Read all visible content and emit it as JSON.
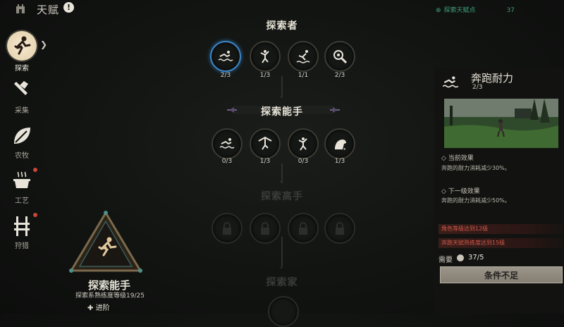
{
  "header": {
    "title": "天赋",
    "info_glyph": "!",
    "points_label": "探索天赋点",
    "points_value": "37"
  },
  "sidebar": {
    "items": [
      {
        "label": "探索",
        "icon": "runner-icon",
        "active": true
      },
      {
        "label": "采集",
        "icon": "axe-icon",
        "active": false
      },
      {
        "label": "农牧",
        "icon": "leaf-icon",
        "active": false
      },
      {
        "label": "工艺",
        "icon": "cooking-pot-icon",
        "active": false,
        "alert": true
      },
      {
        "label": "狩猎",
        "icon": "trap-icon",
        "active": false,
        "alert": true
      }
    ]
  },
  "tree": {
    "tiers": [
      {
        "title": "探索者",
        "nodes": [
          {
            "icon": "swim-icon",
            "level": "2/3",
            "selected": true
          },
          {
            "icon": "climb-icon",
            "level": "1/3"
          },
          {
            "icon": "dive-icon",
            "level": "1/1"
          },
          {
            "icon": "magnifier-icon",
            "level": "2/3"
          }
        ]
      },
      {
        "title": "探索能手",
        "nodes": [
          {
            "icon": "swim-icon",
            "level": "0/3"
          },
          {
            "icon": "glide-icon",
            "level": "1/3"
          },
          {
            "icon": "climb-icon",
            "level": "0/3"
          },
          {
            "icon": "mount-icon",
            "level": "1/3"
          }
        ]
      },
      {
        "title": "探索高手",
        "locked": true
      },
      {
        "title": "探索家",
        "locked": true
      }
    ]
  },
  "emblem": {
    "title": "探索能手",
    "progress_text": "探索系熟练度等级19/25",
    "advance_label": "进阶",
    "advance_glyph": "✚"
  },
  "detail": {
    "title": "奔跑耐力",
    "level": "2/3",
    "current_head": "◇ 当前效果",
    "current_text": "奔跑的耐力消耗减少30%。",
    "next_head": "◇ 下一级效果",
    "next_text": "奔跑的耐力消耗减少50%。",
    "requirements": [
      "角色等级达到12级",
      "奔跑天赋熟练度达到15级"
    ],
    "need_label": "需要",
    "need_value": "37/5",
    "button_label": "条件不足"
  },
  "colors": {
    "accent_green": "#3f9f7d",
    "warning_red": "#d2574a",
    "select_blue": "#3d86c4"
  }
}
